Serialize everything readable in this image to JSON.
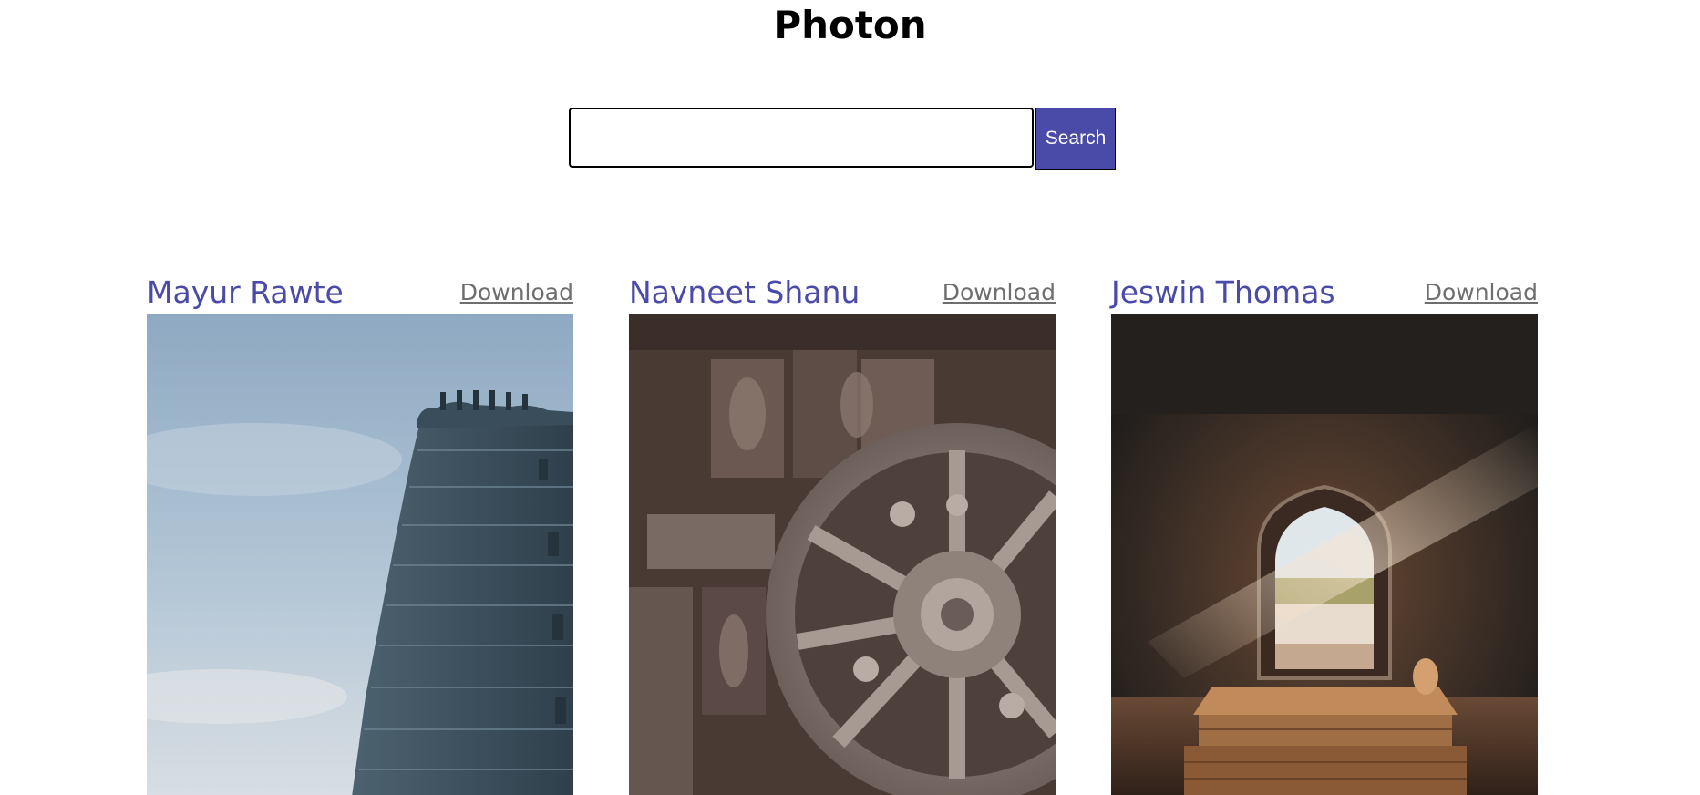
{
  "app": {
    "title": "Photon"
  },
  "search": {
    "value": "",
    "placeholder": "",
    "button_label": "Search"
  },
  "theme": {
    "accent": "#4a4aa8",
    "link": "#6e6e6e"
  },
  "photos": [
    {
      "author": "Mayur Rawte",
      "download_label": "Download",
      "subject": "temple-gopuram-photo"
    },
    {
      "author": "Navneet Shanu",
      "download_label": "Download",
      "subject": "stone-chariot-wheel-photo"
    },
    {
      "author": "Jeswin Thomas",
      "download_label": "Download",
      "subject": "arched-doorway-tomb-photo"
    }
  ]
}
